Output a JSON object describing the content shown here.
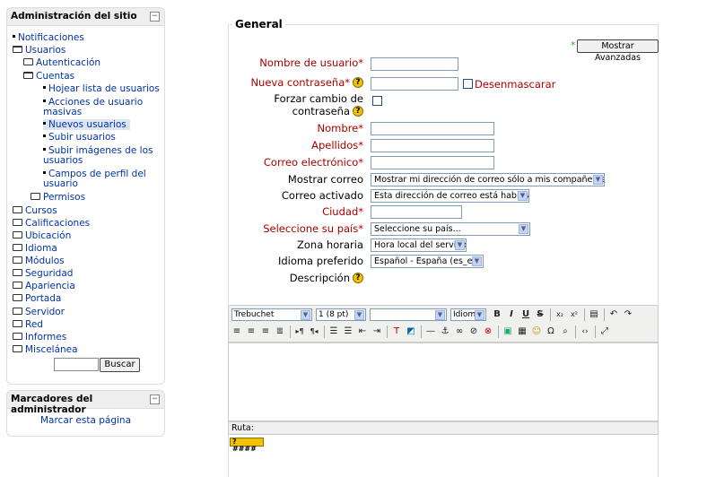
{
  "admin_block": {
    "title": "Administración del sitio",
    "hide_glyph": "−",
    "items": [
      {
        "label": "Notificaciones",
        "icon": "bullet-icon"
      },
      {
        "label": "Usuarios",
        "icon": "folder-open-icon"
      },
      {
        "label": "Autenticación",
        "icon": "folder-icon"
      },
      {
        "label": "Cuentas",
        "icon": "folder-open-icon"
      },
      {
        "label": "Hojear lista de usuarios",
        "icon": "bullet-icon"
      },
      {
        "label": "Acciones de usuario",
        "icon": "bullet-icon"
      },
      {
        "label": "masivas",
        "icon": ""
      },
      {
        "label": "Nuevos usuarios",
        "icon": "bullet-icon"
      },
      {
        "label": "Subir usuarios",
        "icon": "bullet-icon"
      },
      {
        "label": "Subir imágenes de los",
        "icon": "bullet-icon"
      },
      {
        "label": "usuarios",
        "icon": ""
      },
      {
        "label": "Campos de perfil del",
        "icon": "bullet-icon"
      },
      {
        "label": "usuario",
        "icon": ""
      },
      {
        "label": "Permisos",
        "icon": "folder-icon"
      },
      {
        "label": "Cursos",
        "icon": "folder-icon"
      },
      {
        "label": "Calificaciones",
        "icon": "folder-icon"
      },
      {
        "label": "Ubicación",
        "icon": "folder-icon"
      },
      {
        "label": "Idioma",
        "icon": "folder-icon"
      },
      {
        "label": "Módulos",
        "icon": "folder-icon"
      },
      {
        "label": "Seguridad",
        "icon": "folder-icon"
      },
      {
        "label": "Apariencia",
        "icon": "folder-icon"
      },
      {
        "label": "Portada",
        "icon": "folder-icon"
      },
      {
        "label": "Servidor",
        "icon": "folder-icon"
      },
      {
        "label": "Red",
        "icon": "folder-icon"
      },
      {
        "label": "Informes",
        "icon": "folder-icon"
      },
      {
        "label": "Miscelánea",
        "icon": "folder-icon"
      }
    ],
    "search_button": "Buscar"
  },
  "bookmarks_block": {
    "title": "Marcadores del administrador",
    "hide_glyph": "−",
    "link": "Marcar esta página"
  },
  "form": {
    "legend": "General",
    "advanced_star": "*",
    "advanced_button": "Mostrar Avanzadas",
    "username_label": "Nombre de usuario",
    "new_password_label": "Nueva contraseña",
    "unmask_label": "Desenmascarar",
    "force_change_label_1": "Forzar cambio de",
    "force_change_label_2": "contraseña",
    "firstname_label": "Nombre",
    "lastname_label": "Apellidos",
    "email_label": "Correo electrónico",
    "show_email_label": "Mostrar correo",
    "show_email_value": "Mostrar mi dirección de correo sólo a mis compañeros de curso",
    "email_active_label": "Correo activado",
    "email_active_value": "Esta dirección de correo está habilitada",
    "city_label": "Ciudad",
    "country_label": "Seleccione su país",
    "country_value": "Seleccione su país...",
    "timezone_label": "Zona horaria",
    "timezone_value": "Hora local del servidor",
    "language_label": "Idioma preferido",
    "language_value": "Español - España (es_es)",
    "description_label": "Descripción",
    "required_star": "*",
    "help_glyph": "?"
  },
  "editor": {
    "font": "Trebuchet",
    "size": "1 (8 pt)",
    "heading": "",
    "language": "Idioma",
    "path_label": "Ruta:"
  },
  "colors": {
    "required": "#aa0000",
    "link": "#0033aa",
    "help_icon": "#f2c200"
  }
}
